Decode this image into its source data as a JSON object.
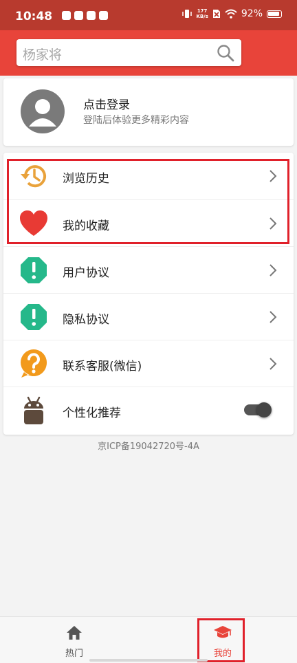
{
  "status_bar": {
    "time": "10:48",
    "net_speed_value": "177",
    "net_speed_unit": "KB/s",
    "battery": "92%"
  },
  "search": {
    "placeholder": "杨家将"
  },
  "login": {
    "title": "点击登录",
    "subtitle": "登陆后体验更多精彩内容"
  },
  "menu": {
    "items": [
      {
        "label": "浏览历史",
        "icon": "history-icon",
        "color": "#e9a23b"
      },
      {
        "label": "我的收藏",
        "icon": "heart-icon",
        "color": "#e83a34"
      },
      {
        "label": "用户协议",
        "icon": "alert-icon",
        "color": "#25b88a"
      },
      {
        "label": "隐私协议",
        "icon": "alert-icon",
        "color": "#25b88a"
      },
      {
        "label": "联系客服(微信)",
        "icon": "question-icon",
        "color": "#f29a1c"
      },
      {
        "label": "个性化推荐",
        "icon": "android-icon",
        "color": "#5d4a3c"
      }
    ]
  },
  "footer": {
    "icp": "京ICP备19042720号-4A"
  },
  "bottom_nav": {
    "items": [
      {
        "label": "热门",
        "icon": "home-icon"
      },
      {
        "label": "我的",
        "icon": "graduation-cap-icon"
      }
    ],
    "active_index": 1
  },
  "colors": {
    "status_bar": "#b83a2e",
    "header": "#e8443a",
    "accent": "#e8443a",
    "highlight": "#e0202a"
  }
}
